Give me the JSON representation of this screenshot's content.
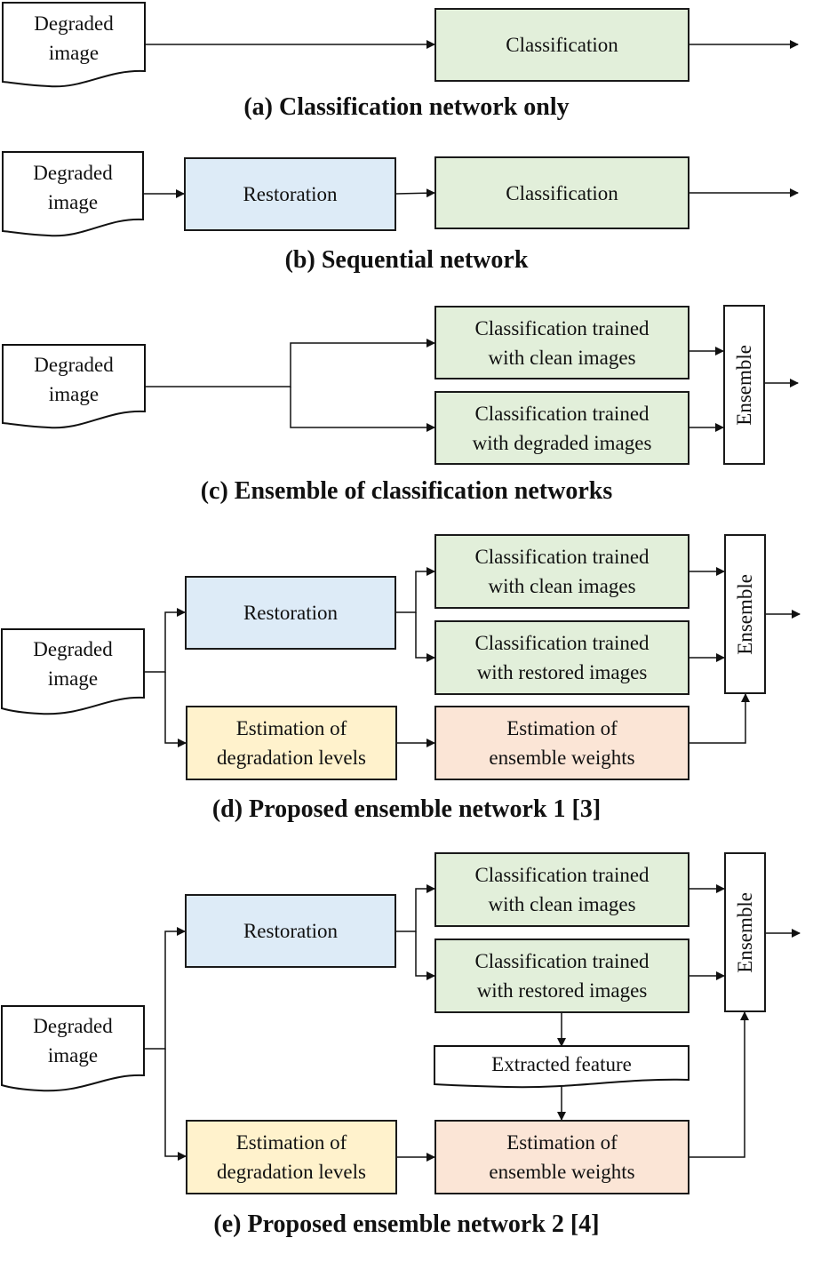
{
  "panels": {
    "a": {
      "caption": "(a) Classification network only",
      "input": "Degraded\nimage",
      "classification": "Classification"
    },
    "b": {
      "caption": "(b) Sequential network",
      "input": "Degraded\nimage",
      "restoration": "Restoration",
      "classification": "Classification"
    },
    "c": {
      "caption": "(c) Ensemble of classification networks",
      "input": "Degraded\nimage",
      "clf_clean": "Classification trained\nwith clean images",
      "clf_degraded": "Classification trained\nwith degraded images",
      "ensemble": "Ensemble"
    },
    "d": {
      "caption": "(d) Proposed ensemble network 1 [3]",
      "input": "Degraded\nimage",
      "restoration": "Restoration",
      "clf_clean": "Classification trained\nwith clean images",
      "clf_restored": "Classification trained\nwith restored images",
      "degradation": "Estimation of\ndegradation levels",
      "weights": "Estimation of\nensemble weights",
      "ensemble": "Ensemble"
    },
    "e": {
      "caption": "(e) Proposed ensemble network 2 [4]",
      "input": "Degraded\nimage",
      "restoration": "Restoration",
      "clf_clean": "Classification trained\nwith clean images",
      "clf_restored": "Classification trained\nwith restored images",
      "feature": "Extracted feature",
      "degradation": "Estimation of\ndegradation levels",
      "weights": "Estimation of\nensemble weights",
      "ensemble": "Ensemble"
    }
  },
  "colors": {
    "classification": "#e2efda",
    "restoration": "#ddebf7",
    "degradation": "#fff2cc",
    "weights": "#fbe5d6"
  }
}
